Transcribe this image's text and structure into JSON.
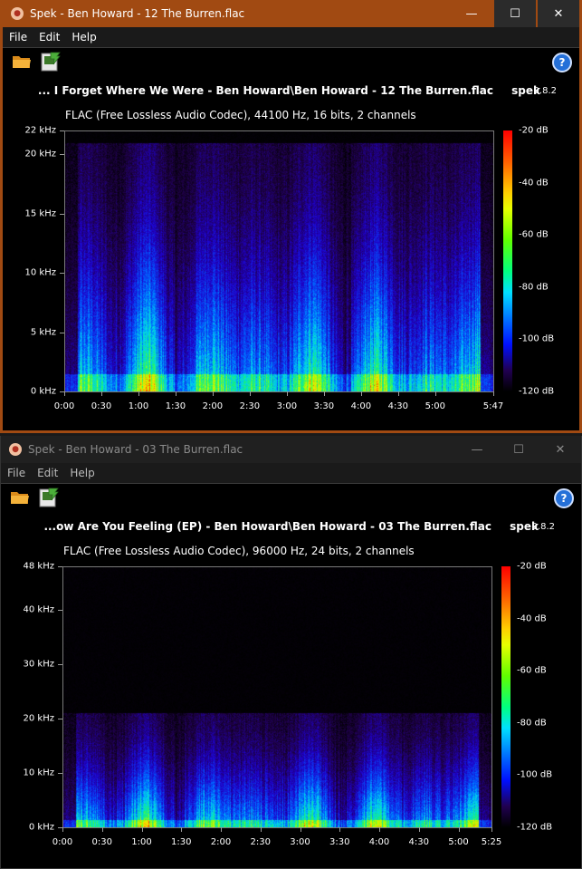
{
  "windows": [
    {
      "title": "Spek - Ben Howard - 12 The Burren.flac",
      "menu": [
        "File",
        "Edit",
        "Help"
      ],
      "controls": {
        "minimize": "—",
        "maximize": "☐",
        "close": "✕"
      },
      "file_title": "... I Forget Where We Were - Ben Howard\\Ben Howard - 12 The Burren.flac",
      "brand": "spek",
      "version": "0.8.2",
      "file_info": "FLAC (Free Lossless Audio Codec), 44100 Hz, 16 bits, 2 channels",
      "chart_data": {
        "type": "heatmap",
        "y_ticks": [
          "22 kHz",
          "20 kHz",
          "15 kHz",
          "10 kHz",
          "5 kHz",
          "0 kHz"
        ],
        "y_tick_values": [
          22,
          20,
          15,
          10,
          5,
          0
        ],
        "y_max": 22,
        "x_ticks": [
          "0:00",
          "0:30",
          "1:00",
          "1:30",
          "2:00",
          "2:30",
          "3:00",
          "3:30",
          "4:00",
          "4:30",
          "5:00",
          "5:47"
        ],
        "x_tick_values": [
          0,
          30,
          60,
          90,
          120,
          150,
          180,
          210,
          240,
          270,
          300,
          347
        ],
        "x_max": 347,
        "cutoff_khz": 21,
        "scale_labels": [
          "-20 dB",
          "-40 dB",
          "-60 dB",
          "-80 dB",
          "-100 dB",
          "-120 dB"
        ],
        "scale_values": [
          -20,
          -40,
          -60,
          -80,
          -100,
          -120
        ]
      }
    },
    {
      "title": "Spek - Ben Howard - 03 The Burren.flac",
      "menu": [
        "File",
        "Edit",
        "Help"
      ],
      "controls": {
        "minimize": "—",
        "maximize": "☐",
        "close": "✕"
      },
      "file_title": "...ow Are You Feeling (EP) - Ben Howard\\Ben Howard - 03 The Burren.flac",
      "brand": "spek",
      "version": "0.8.2",
      "file_info": "FLAC (Free Lossless Audio Codec), 96000 Hz, 24 bits, 2 channels",
      "chart_data": {
        "type": "heatmap",
        "y_ticks": [
          "48 kHz",
          "40 kHz",
          "30 kHz",
          "20 kHz",
          "10 kHz",
          "0 kHz"
        ],
        "y_tick_values": [
          48,
          40,
          30,
          20,
          10,
          0
        ],
        "y_max": 48,
        "x_ticks": [
          "0:00",
          "0:30",
          "1:00",
          "1:30",
          "2:00",
          "2:30",
          "3:00",
          "3:30",
          "4:00",
          "4:30",
          "5:00",
          "5:25"
        ],
        "x_tick_values": [
          0,
          30,
          60,
          90,
          120,
          150,
          180,
          210,
          240,
          270,
          300,
          325
        ],
        "x_max": 325,
        "cutoff_khz": 21,
        "scale_labels": [
          "-20 dB",
          "-40 dB",
          "-60 dB",
          "-80 dB",
          "-100 dB",
          "-120 dB"
        ],
        "scale_values": [
          -20,
          -40,
          -60,
          -80,
          -100,
          -120
        ]
      }
    }
  ]
}
